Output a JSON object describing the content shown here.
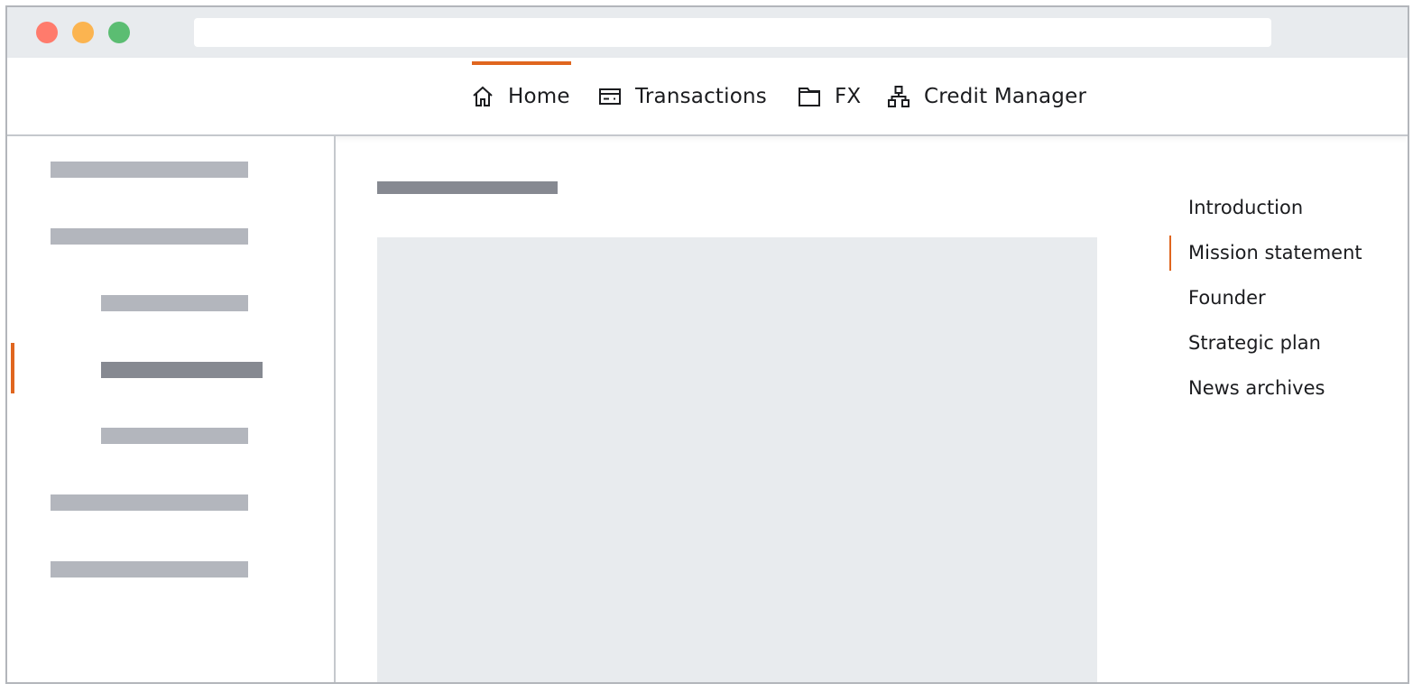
{
  "window": {
    "traffic_lights": [
      {
        "name": "close",
        "color": "#ff7b6c"
      },
      {
        "name": "minimize",
        "color": "#fbb450"
      },
      {
        "name": "maximize",
        "color": "#5bbd72"
      }
    ],
    "url": ""
  },
  "nav": {
    "items": [
      {
        "label": "Home",
        "icon": "home-icon",
        "active": true
      },
      {
        "label": "Transactions",
        "icon": "card-icon",
        "active": false
      },
      {
        "label": "FX",
        "icon": "folder-icon",
        "active": false
      },
      {
        "label": "Credit Manager",
        "icon": "sitemap-icon",
        "active": false
      }
    ],
    "accent_color": "#e0661f"
  },
  "sidebar": {
    "items": [
      {
        "level": 1,
        "active": false
      },
      {
        "level": 1,
        "active": false
      },
      {
        "level": 2,
        "active": false
      },
      {
        "level": 2,
        "active": true
      },
      {
        "level": 2,
        "active": false
      },
      {
        "level": 1,
        "active": false
      },
      {
        "level": 1,
        "active": false
      }
    ]
  },
  "toc": {
    "items": [
      {
        "label": "Introduction",
        "active": false
      },
      {
        "label": "Mission statement",
        "active": true
      },
      {
        "label": "Founder",
        "active": false
      },
      {
        "label": "Strategic plan",
        "active": false
      },
      {
        "label": "News archives",
        "active": false
      }
    ]
  }
}
